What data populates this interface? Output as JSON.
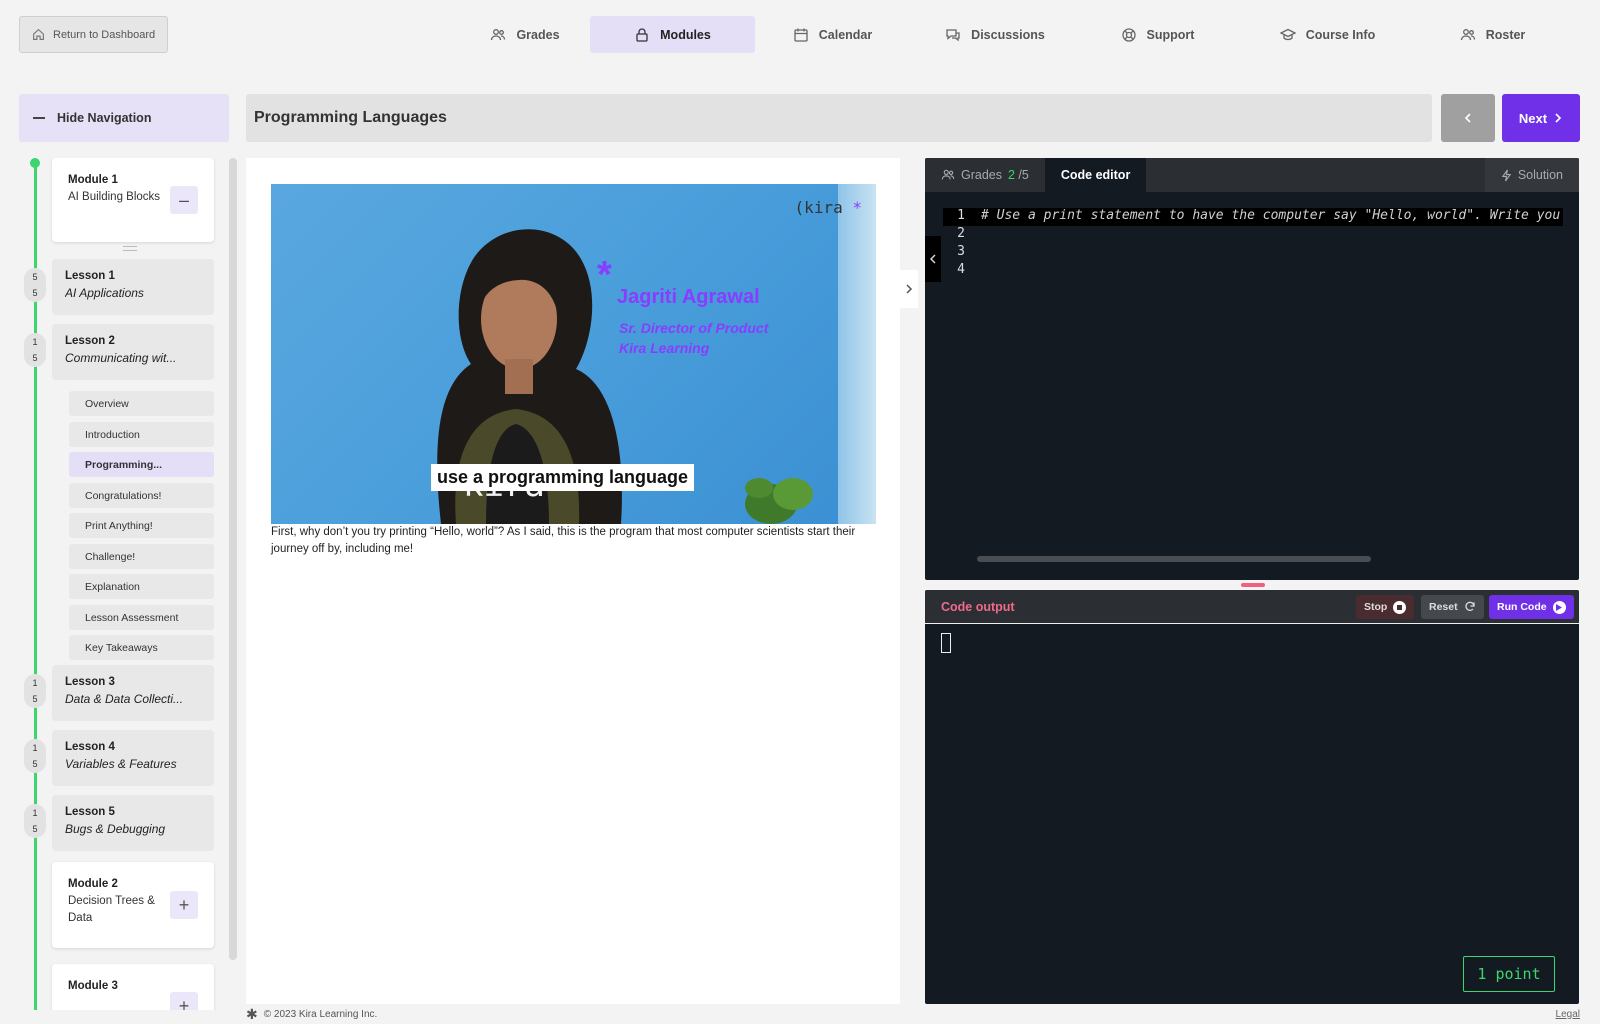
{
  "header": {
    "return_label": "Return to Dashboard",
    "nav": [
      {
        "label": "Grades",
        "icon": "users-icon",
        "active": false
      },
      {
        "label": "Modules",
        "icon": "lock-icon",
        "active": true
      },
      {
        "label": "Calendar",
        "icon": "calendar-icon",
        "active": false
      },
      {
        "label": "Discussions",
        "icon": "chat-icon",
        "active": false
      },
      {
        "label": "Support",
        "icon": "lifebuoy-icon",
        "active": false
      },
      {
        "label": "Course Info",
        "icon": "graduation-cap-icon",
        "active": false
      },
      {
        "label": "Roster",
        "icon": "users-icon",
        "active": false
      }
    ]
  },
  "toolbar": {
    "hide_nav_label": "Hide Navigation",
    "page_title": "Programming Languages",
    "prev_icon": "chevron-left-icon",
    "next_label": "Next"
  },
  "sidebar": {
    "module1": {
      "title": "Module 1",
      "subtitle": "AI Building Blocks",
      "toggle": "–"
    },
    "lessons": [
      {
        "title": "Lesson 1",
        "subtitle": "AI Applications",
        "score_top": "5",
        "score_bottom": "5"
      },
      {
        "title": "Lesson 2",
        "subtitle": "Communicating wit...",
        "score_top": "1",
        "score_bottom": "5"
      },
      {
        "title": "Lesson 3",
        "subtitle": "Data & Data Collecti...",
        "score_top": "1",
        "score_bottom": "5"
      },
      {
        "title": "Lesson 4",
        "subtitle": "Variables & Features",
        "score_top": "1",
        "score_bottom": "5"
      },
      {
        "title": "Lesson 5",
        "subtitle": "Bugs & Debugging",
        "score_top": "1",
        "score_bottom": "5"
      }
    ],
    "pages": [
      {
        "label": "Overview",
        "active": false
      },
      {
        "label": "Introduction",
        "active": false
      },
      {
        "label": "Programming...",
        "active": true
      },
      {
        "label": "Congratulations!",
        "active": false
      },
      {
        "label": "Print Anything!",
        "active": false
      },
      {
        "label": "Challenge!",
        "active": false
      },
      {
        "label": "Explanation",
        "active": false
      },
      {
        "label": "Lesson Assessment",
        "active": false
      },
      {
        "label": "Key Takeaways",
        "active": false
      }
    ],
    "module2": {
      "title": "Module 2",
      "subtitle": "Decision Trees & Data",
      "toggle": "+"
    },
    "module3": {
      "title": "Module 3",
      "subtitle": "",
      "toggle": "+"
    }
  },
  "content": {
    "video": {
      "brand": "(kira",
      "name": "Jagriti Agrawal",
      "role_line1": "Sr. Director of Product",
      "role_line2": "Kira Learning",
      "caption": "use a programming language"
    },
    "description": "First, why don’t you try printing “Hello, world”? As I said, this is the program that most computer scientists start their journey off by, including me!"
  },
  "editor": {
    "grades_label": "Grades",
    "grades_score": "2",
    "grades_total": " /5",
    "tab_label": "Code editor",
    "solution_label": "Solution",
    "lines": [
      {
        "num": "1",
        "code": "# Use a print statement to have the computer say \"Hello, world\". Write you"
      },
      {
        "num": "2",
        "code": ""
      },
      {
        "num": "3",
        "code": ""
      },
      {
        "num": "4",
        "code": ""
      }
    ]
  },
  "output": {
    "title": "Code output",
    "stop_label": "Stop",
    "reset_label": "Reset",
    "run_label": "Run Code",
    "points": "1 point"
  },
  "footer": {
    "copyright": "© 2023 Kira Learning Inc.",
    "legal": "Legal"
  },
  "colors": {
    "accent": "#7030e8",
    "progress_green": "#3dd56d",
    "output_title": "#f06a8a"
  }
}
